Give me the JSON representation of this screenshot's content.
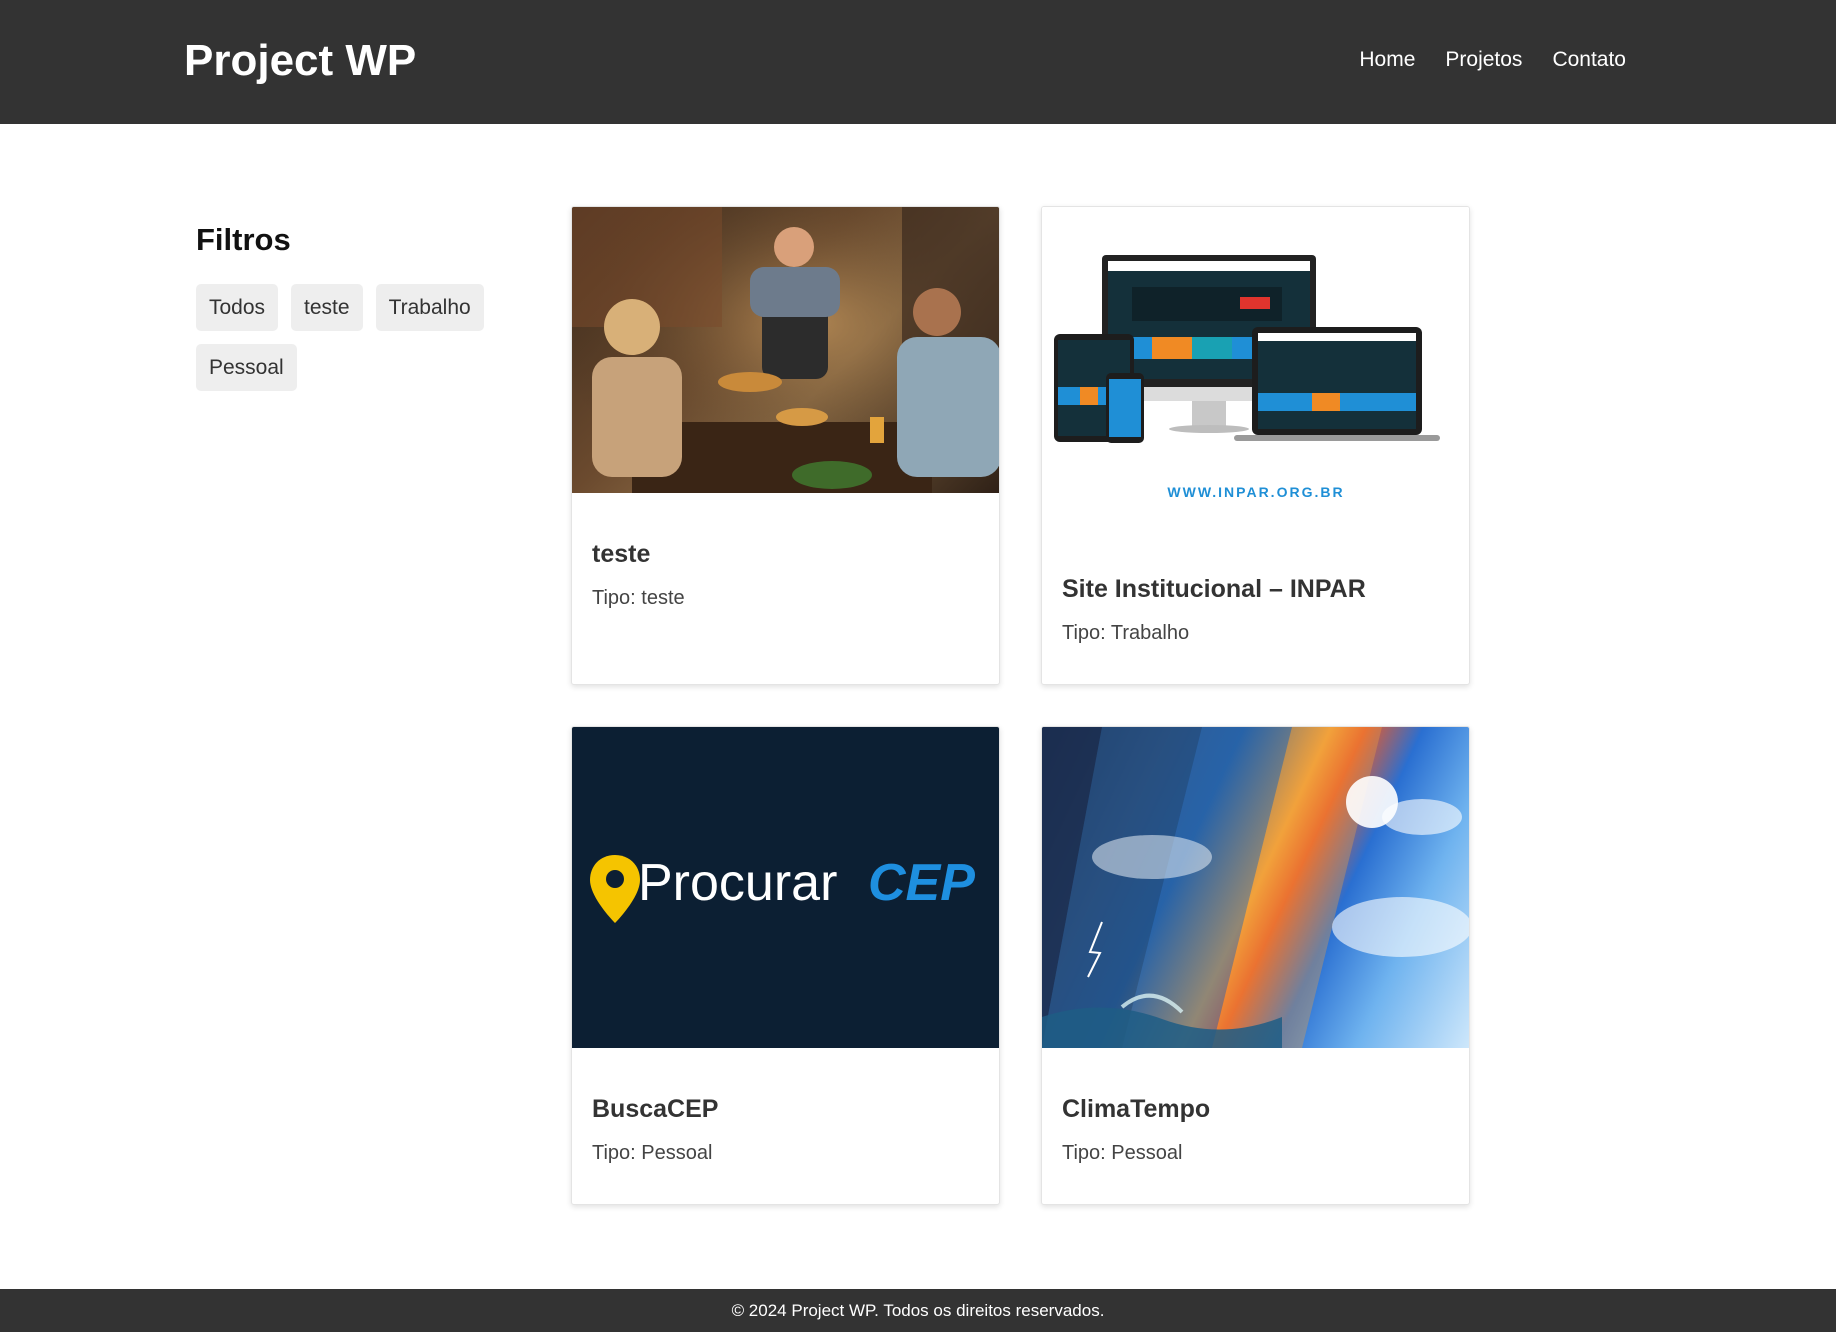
{
  "header": {
    "brand": "Project WP",
    "nav": [
      {
        "label": "Home"
      },
      {
        "label": "Projetos"
      },
      {
        "label": "Contato"
      }
    ]
  },
  "sidebar": {
    "title": "Filtros",
    "filters": [
      {
        "label": "Todos"
      },
      {
        "label": "teste"
      },
      {
        "label": "Trabalho"
      },
      {
        "label": "Pessoal"
      }
    ]
  },
  "projects": [
    {
      "title": "teste",
      "type": "Tipo: teste"
    },
    {
      "title": "Site Institucional – INPAR",
      "type": "Tipo: Trabalho",
      "image_text": "WWW.INPAR.ORG.BR"
    },
    {
      "title": "BuscaCEP",
      "type": "Tipo: Pessoal",
      "image_text_a": "Procurar",
      "image_text_b": "CEP"
    },
    {
      "title": "ClimaTempo",
      "type": "Tipo: Pessoal"
    }
  ],
  "footer": {
    "text": "© 2024 Project WP. Todos os direitos reservados."
  },
  "colors": {
    "header_bg": "#333333",
    "footer_bg": "#333333",
    "filter_bg": "#eeeeee",
    "procurar_bg": "#0c1f33",
    "procurar_accent": "#1e8fe0",
    "pin_yellow": "#f5c400",
    "inpar_blue": "#1f8fd6"
  }
}
